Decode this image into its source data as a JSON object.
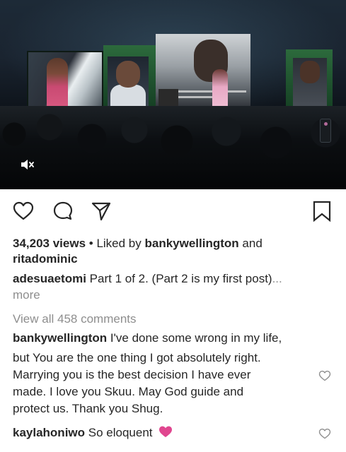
{
  "post": {
    "video": {
      "muted_icon": "speaker-muted-icon"
    },
    "actions": {
      "like_icon": "heart-outline-icon",
      "comment_icon": "speech-bubble-icon",
      "share_icon": "paper-plane-icon",
      "save_icon": "bookmark-icon"
    },
    "views": "34,203 views",
    "liked_by_prefix": "• Liked by",
    "liked_by_user1": "bankywellington",
    "liked_by_and": "and",
    "liked_by_user2": "ritadominic",
    "caption_user": "adesuaetomi",
    "caption_text": "Part 1 of 2. (Part 2 is my first post)",
    "caption_ellipsis": "...",
    "more_label": "more",
    "view_all_comments": "View all 458 comments",
    "comments": [
      {
        "user": "bankywellington",
        "text_lines": [
          "I've done some wrong in my life,",
          "but You are the one thing I got absolutely right.",
          "Marrying you is the best decision I have ever",
          "made. I love you Skuu. May God guide and",
          "protect us. Thank you Shug."
        ],
        "like_icon": "heart-outline-icon"
      },
      {
        "user": "kaylahoniwo",
        "text": "So eloquent",
        "emoji_icon": "pink-heart-icon",
        "like_icon": "heart-outline-icon"
      }
    ]
  },
  "colors": {
    "text": "#262626",
    "muted": "#8e8e8e",
    "pink_heart": "#e0468f"
  }
}
